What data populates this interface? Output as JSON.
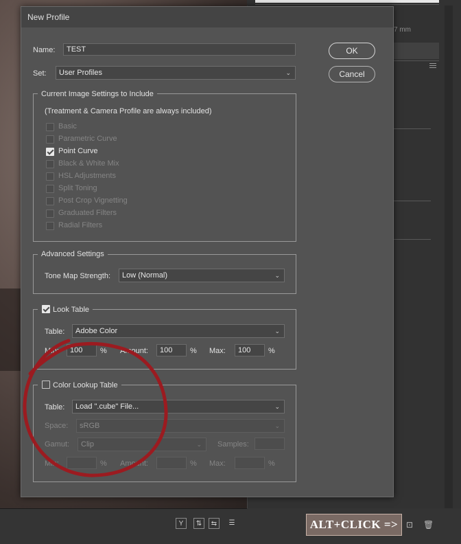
{
  "background": {
    "units_text": "7 mm",
    "annotation_label": "ALT+CLICK =>",
    "annotation_color": "#9b1b20"
  },
  "dialog": {
    "title": "New Profile",
    "name_label": "Name:",
    "name_value": "TEST",
    "set_label": "Set:",
    "set_value": "User Profiles",
    "ok_label": "OK",
    "cancel_label": "Cancel",
    "current_settings": {
      "title": "Current Image Settings to Include",
      "note": "(Treatment & Camera Profile are always included)",
      "items": [
        {
          "label": "Basic",
          "checked": false
        },
        {
          "label": "Parametric Curve",
          "checked": false
        },
        {
          "label": "Point Curve",
          "checked": true
        },
        {
          "label": "Black & White Mix",
          "checked": false
        },
        {
          "label": "HSL Adjustments",
          "checked": false
        },
        {
          "label": "Split Toning",
          "checked": false
        },
        {
          "label": "Post Crop Vignetting",
          "checked": false
        },
        {
          "label": "Graduated Filters",
          "checked": false
        },
        {
          "label": "Radial Filters",
          "checked": false
        }
      ]
    },
    "advanced": {
      "title": "Advanced Settings",
      "tone_label": "Tone Map Strength:",
      "tone_value": "Low (Normal)"
    },
    "look_table": {
      "title": "Look Table",
      "checked": true,
      "table_label": "Table:",
      "table_value": "Adobe Color",
      "min_label": "Min:",
      "min_value": "100",
      "amount_label": "Amount:",
      "amount_value": "100",
      "max_label": "Max:",
      "max_value": "100",
      "percent": "%"
    },
    "color_lookup": {
      "title": "Color Lookup Table",
      "checked": false,
      "table_label": "Table:",
      "table_value": "Load \".cube\" File...",
      "space_label": "Space:",
      "space_value": "sRGB",
      "gamut_label": "Gamut:",
      "gamut_value": "Clip",
      "samples_label": "Samples:",
      "samples_value": "",
      "min_label": "Min:",
      "min_value": "",
      "amount_label": "Amount:",
      "amount_value": "",
      "max_label": "Max:",
      "max_value": "",
      "percent": "%"
    }
  }
}
